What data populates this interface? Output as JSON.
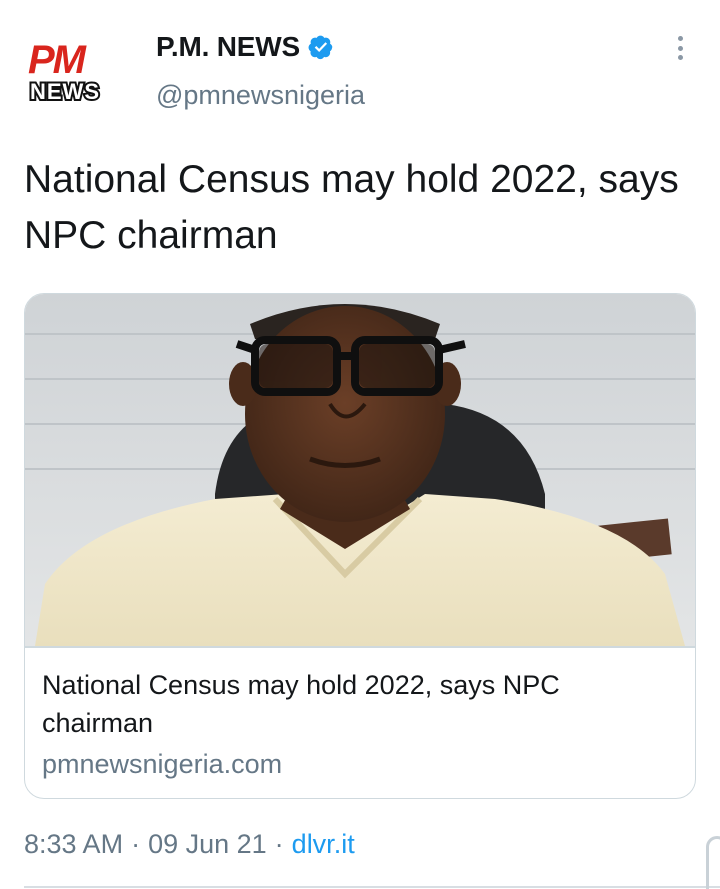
{
  "header": {
    "avatar_icon": "pm-news-logo",
    "avatar_text_top": "PM",
    "avatar_text_bottom": "NEWS",
    "display_name": "P.M. NEWS",
    "verified_icon": "verified-badge-icon",
    "handle": "@pmnewsnigeria",
    "more_icon": "more-vertical-icon"
  },
  "tweet": {
    "text": "National Census may hold 2022, says NPC chairman"
  },
  "card": {
    "image_icon": "portrait-photo",
    "title": "National Census may hold 2022, says NPC chairman",
    "domain": "pmnewsnigeria.com"
  },
  "meta": {
    "time": "8:33 AM",
    "separator": "·",
    "date": "09 Jun 21",
    "source": "dlvr.it"
  },
  "colors": {
    "accent": "#1d9bf0",
    "logo_red": "#d9251d",
    "secondary_text": "#657786",
    "border": "#cfd9de"
  }
}
